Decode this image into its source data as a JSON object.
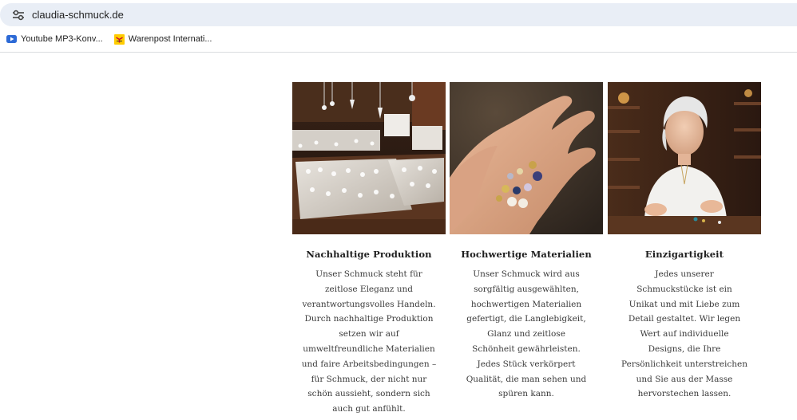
{
  "browser": {
    "url": "claudia-schmuck.de",
    "bookmarks": [
      {
        "label": "Youtube MP3-Konv...",
        "icon": "youtube-icon"
      },
      {
        "label": "Warenpost Internati...",
        "icon": "dhl-icon"
      }
    ]
  },
  "features": [
    {
      "title": "Nachhaltige Produktion",
      "text": "Unser Schmuck steht für zeitlose Eleganz und verantwortungsvolles Handeln. Durch nachhaltige Produktion setzen wir auf umweltfreundliche Materialien und faire Arbeitsbedingungen – für Schmuck, der nicht nur schön aussieht, sondern sich auch gut anfühlt.",
      "image": "jewelry-display-photo"
    },
    {
      "title": "Hochwertige Materialien",
      "text": "Unser Schmuck wird aus sorgfältig ausgewählten, hochwertigen Materialien gefertigt, die Langlebigkeit, Glanz und zeitlose Schönheit gewährleisten. Jedes Stück verkörpert Qualität, die man sehen und spüren kann.",
      "image": "hand-with-gems-photo"
    },
    {
      "title": "Einzigartigkeit",
      "text": "Jedes unserer Schmuckstücke ist ein Unikat und mit Liebe zum Detail gestaltet. Wir legen Wert auf individuelle Designs, die Ihre Persönlichkeit unterstreichen und Sie aus der Masse hervorstechen lassen.",
      "image": "jeweler-at-work-photo"
    }
  ],
  "colors": {
    "addressBar": "#e9eef6",
    "titleText": "#1e1e1e",
    "bodyText": "#3a3a3a"
  }
}
